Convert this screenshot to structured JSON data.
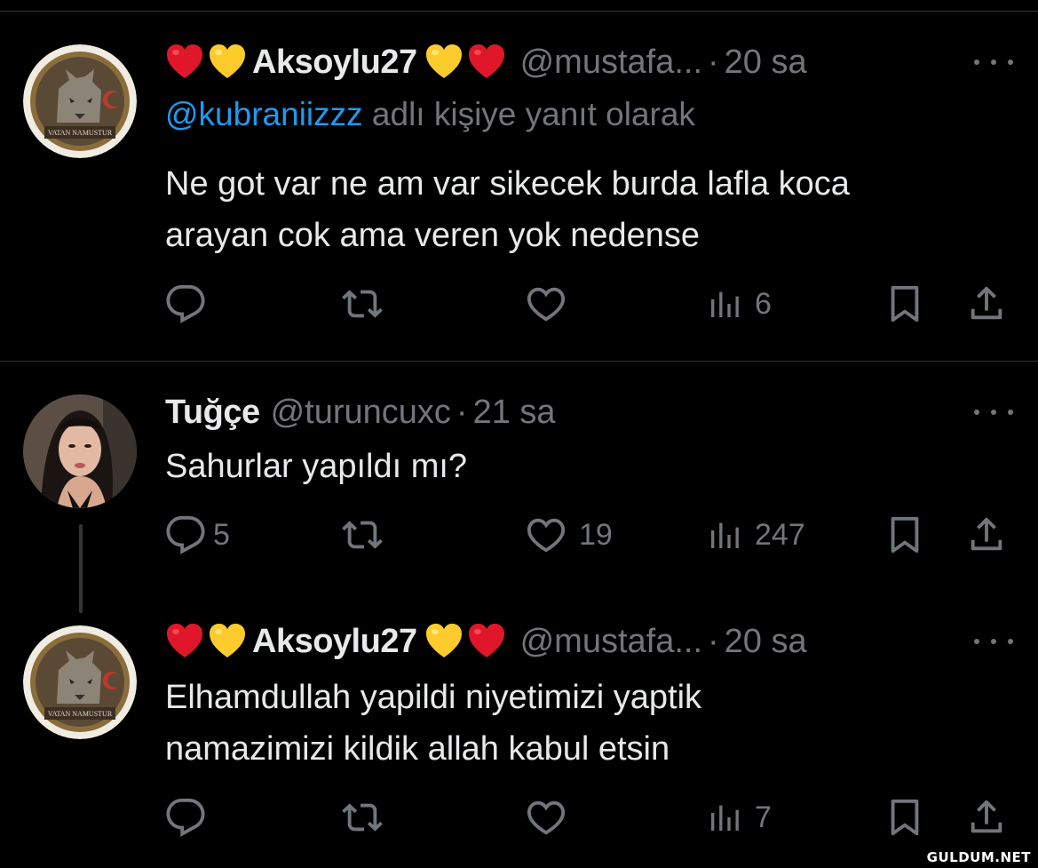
{
  "tweets": [
    {
      "display_name": "Aksoylu27",
      "handle": "@mustafa...",
      "time": "20 sa",
      "reply_prefix": "@kubraniizzz",
      "reply_suffix": " adlı kişiye yanıt olarak",
      "text": "Ne got var ne am var sikecek burda lafla koca\narayan cok ama veren yok nedense",
      "stats": {
        "replies": "",
        "retweets": "",
        "likes": "",
        "views": "6"
      }
    },
    {
      "display_name": "Tuğçe",
      "handle": "@turuncuxc",
      "time": "21 sa",
      "text": "Sahurlar yapıldı mı?",
      "stats": {
        "replies": "5",
        "retweets": "",
        "likes": "19",
        "views": "247"
      }
    },
    {
      "display_name": "Aksoylu27",
      "handle": "@mustafa...",
      "time": "20 sa",
      "text": "Elhamdullah yapildi niyetimizi yaptik\nnamazimizi kildik allah kabul etsin",
      "stats": {
        "replies": "",
        "retweets": "",
        "likes": "",
        "views": "7"
      }
    }
  ],
  "separator": "·",
  "avatar_badge_text": "VATAN NAMUSTUR",
  "watermark": "GULDUM.NET",
  "colors": {
    "background": "#000000",
    "text": "#e7e9ea",
    "muted": "#71767b",
    "link": "#1d9bf0",
    "divider": "#2f3336"
  },
  "icons": [
    "red-heart-emoji",
    "yellow-heart-emoji",
    "reply-icon",
    "retweet-icon",
    "like-icon",
    "views-icon",
    "bookmark-icon",
    "share-icon",
    "more-icon"
  ]
}
